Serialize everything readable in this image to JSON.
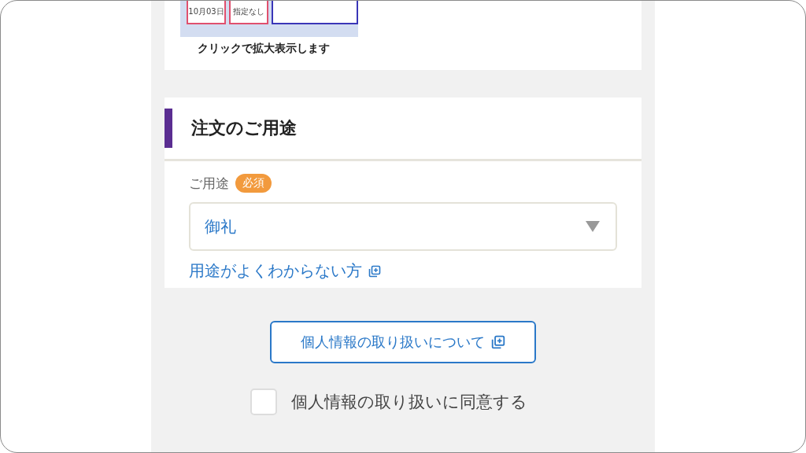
{
  "preview": {
    "cells": [
      "10月03日",
      "指定なし",
      ""
    ],
    "caption": "クリックで拡大表示します"
  },
  "section": {
    "title": "注文のご用途",
    "field_label": "ご用途",
    "required_badge": "必須",
    "select_value": "御礼",
    "help_link": "用途がよくわからない方"
  },
  "privacy_button": "個人情報の取り扱いについて",
  "consent": {
    "label": "個人情報の取り扱いに同意する",
    "checked": false
  }
}
